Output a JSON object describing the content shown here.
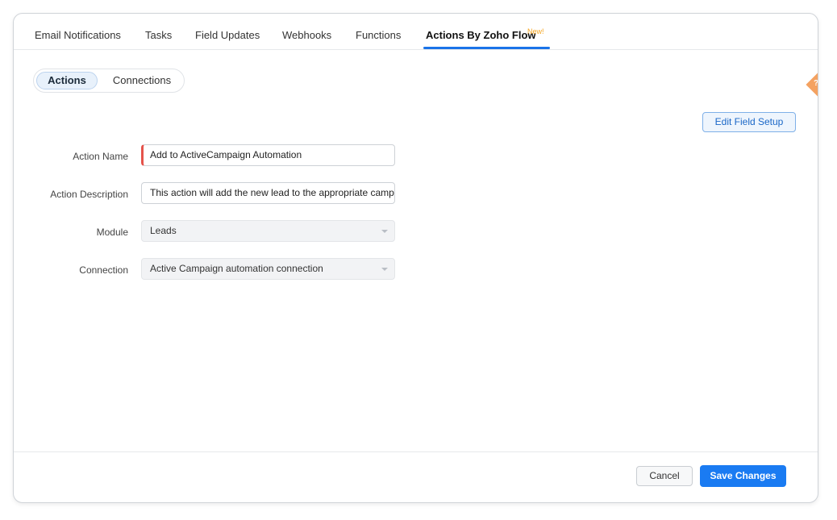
{
  "tabs": [
    {
      "label": "Email Notifications"
    },
    {
      "label": "Tasks"
    },
    {
      "label": "Field Updates"
    },
    {
      "label": "Webhooks"
    },
    {
      "label": "Functions"
    },
    {
      "label": "Actions By Zoho Flow",
      "active": true
    }
  ],
  "new_badge": "New!",
  "toggle": {
    "actions": "Actions",
    "connections": "Connections",
    "selected": "Actions"
  },
  "help_icon": "?",
  "edit_field_setup": "Edit Field Setup",
  "form": {
    "action_name_label": "Action Name",
    "action_name_value": "Add to ActiveCampaign Automation",
    "action_description_label": "Action Description",
    "action_description_value": "This action will add the new lead to the appropriate campaign",
    "module_label": "Module",
    "module_value": "Leads",
    "connection_label": "Connection",
    "connection_value": "Active Campaign automation connection"
  },
  "footer": {
    "cancel": "Cancel",
    "save": "Save Changes"
  },
  "colors": {
    "accent": "#1a7bf2",
    "tab_underline": "#1a73e8",
    "new_badge": "#f5a623",
    "required_marker": "#e5534b",
    "help_tab": "#f4a261"
  }
}
